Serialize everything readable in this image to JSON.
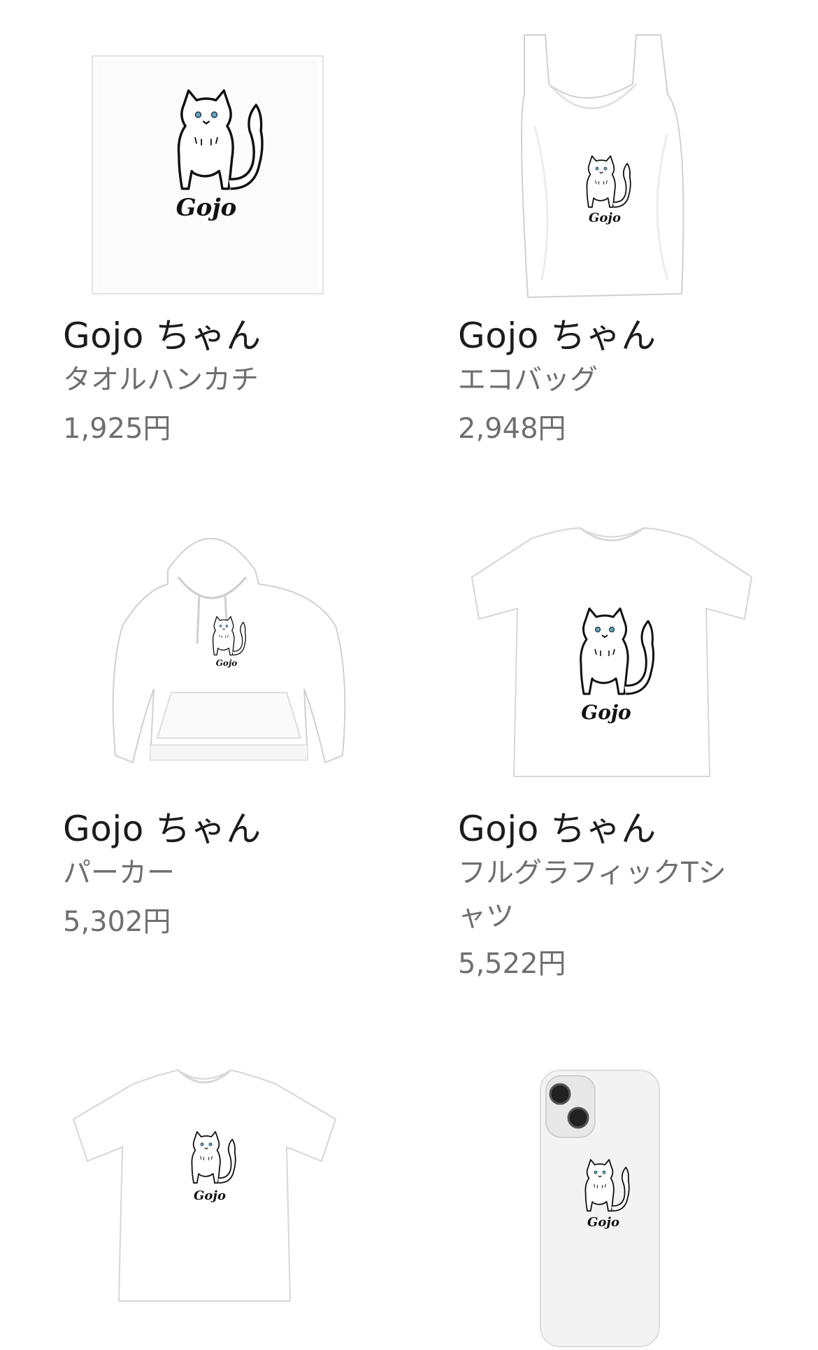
{
  "products": [
    {
      "title": "Gojo ちゃん",
      "category": "タオルハンカチ",
      "price": "1,925円",
      "print_logo": "Gojo",
      "thumb_icon": "towel-handkerchief-icon"
    },
    {
      "title": "Gojo ちゃん",
      "category": "エコバッグ",
      "price": "2,948円",
      "print_logo": "Gojo",
      "thumb_icon": "eco-bag-icon"
    },
    {
      "title": "Gojo ちゃん",
      "category": "パーカー",
      "price": "5,302円",
      "print_logo": "Gojo",
      "thumb_icon": "hoodie-icon"
    },
    {
      "title": "Gojo ちゃん",
      "category": "フルグラフィックTシャツ",
      "price": "5,522円",
      "print_logo": "Gojo",
      "thumb_icon": "full-graphic-tshirt-icon"
    },
    {
      "print_logo": "Gojo",
      "thumb_icon": "tshirt-icon"
    },
    {
      "print_logo": "Gojo",
      "thumb_icon": "smartphone-case-icon"
    }
  ],
  "colors": {
    "background": "#ffffff",
    "title": "#1c1c1c",
    "meta": "#6f6f6f",
    "product_fill": "#ffffff",
    "product_shadow": "#d9d9d9",
    "cat_outline": "#111111",
    "cat_eyes": "#5aa6c9"
  }
}
